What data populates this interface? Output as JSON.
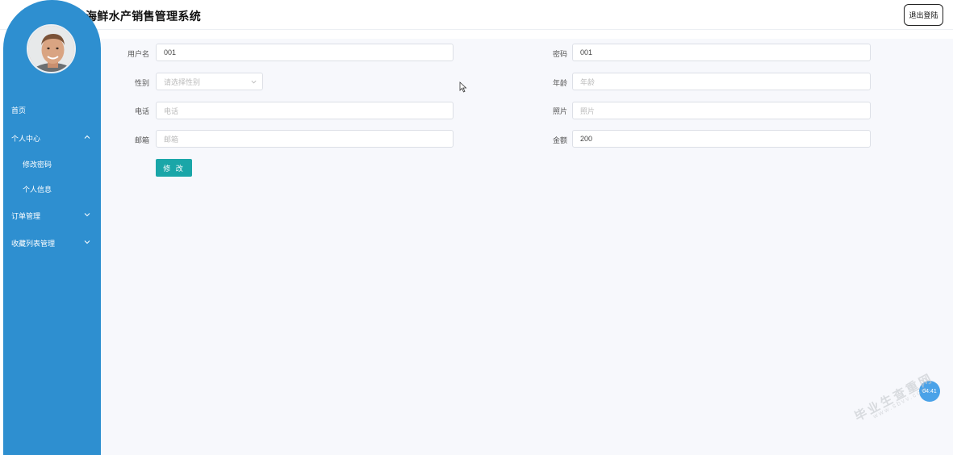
{
  "header": {
    "title": "海鲜水产销售管理系统",
    "logout_label": "退出登陆"
  },
  "sidebar": {
    "items": [
      {
        "label": "首页"
      },
      {
        "label": "个人中心"
      },
      {
        "label": "修改密码"
      },
      {
        "label": "个人信息"
      },
      {
        "label": "订单管理"
      },
      {
        "label": "收藏列表管理"
      }
    ]
  },
  "form": {
    "username": {
      "label": "用户名",
      "value": "001"
    },
    "password": {
      "label": "密码",
      "value": "001"
    },
    "gender": {
      "label": "性别",
      "placeholder": "请选择性别"
    },
    "age": {
      "label": "年龄",
      "placeholder": "年龄"
    },
    "phone": {
      "label": "电话",
      "placeholder": "电话"
    },
    "photo": {
      "label": "照片",
      "placeholder": "照片"
    },
    "email": {
      "label": "邮箱",
      "placeholder": "邮箱"
    },
    "balance": {
      "label": "金额",
      "value": "200"
    },
    "submit_label": "修 改"
  },
  "float_badge": {
    "text": "04:41"
  },
  "watermark": {
    "main": "毕业生查重网",
    "url": "www.sbvv.com"
  },
  "colors": {
    "sidebar": "#2e8fd0",
    "submit": "#1aa6a8",
    "content_bg": "#f7f8fc"
  }
}
